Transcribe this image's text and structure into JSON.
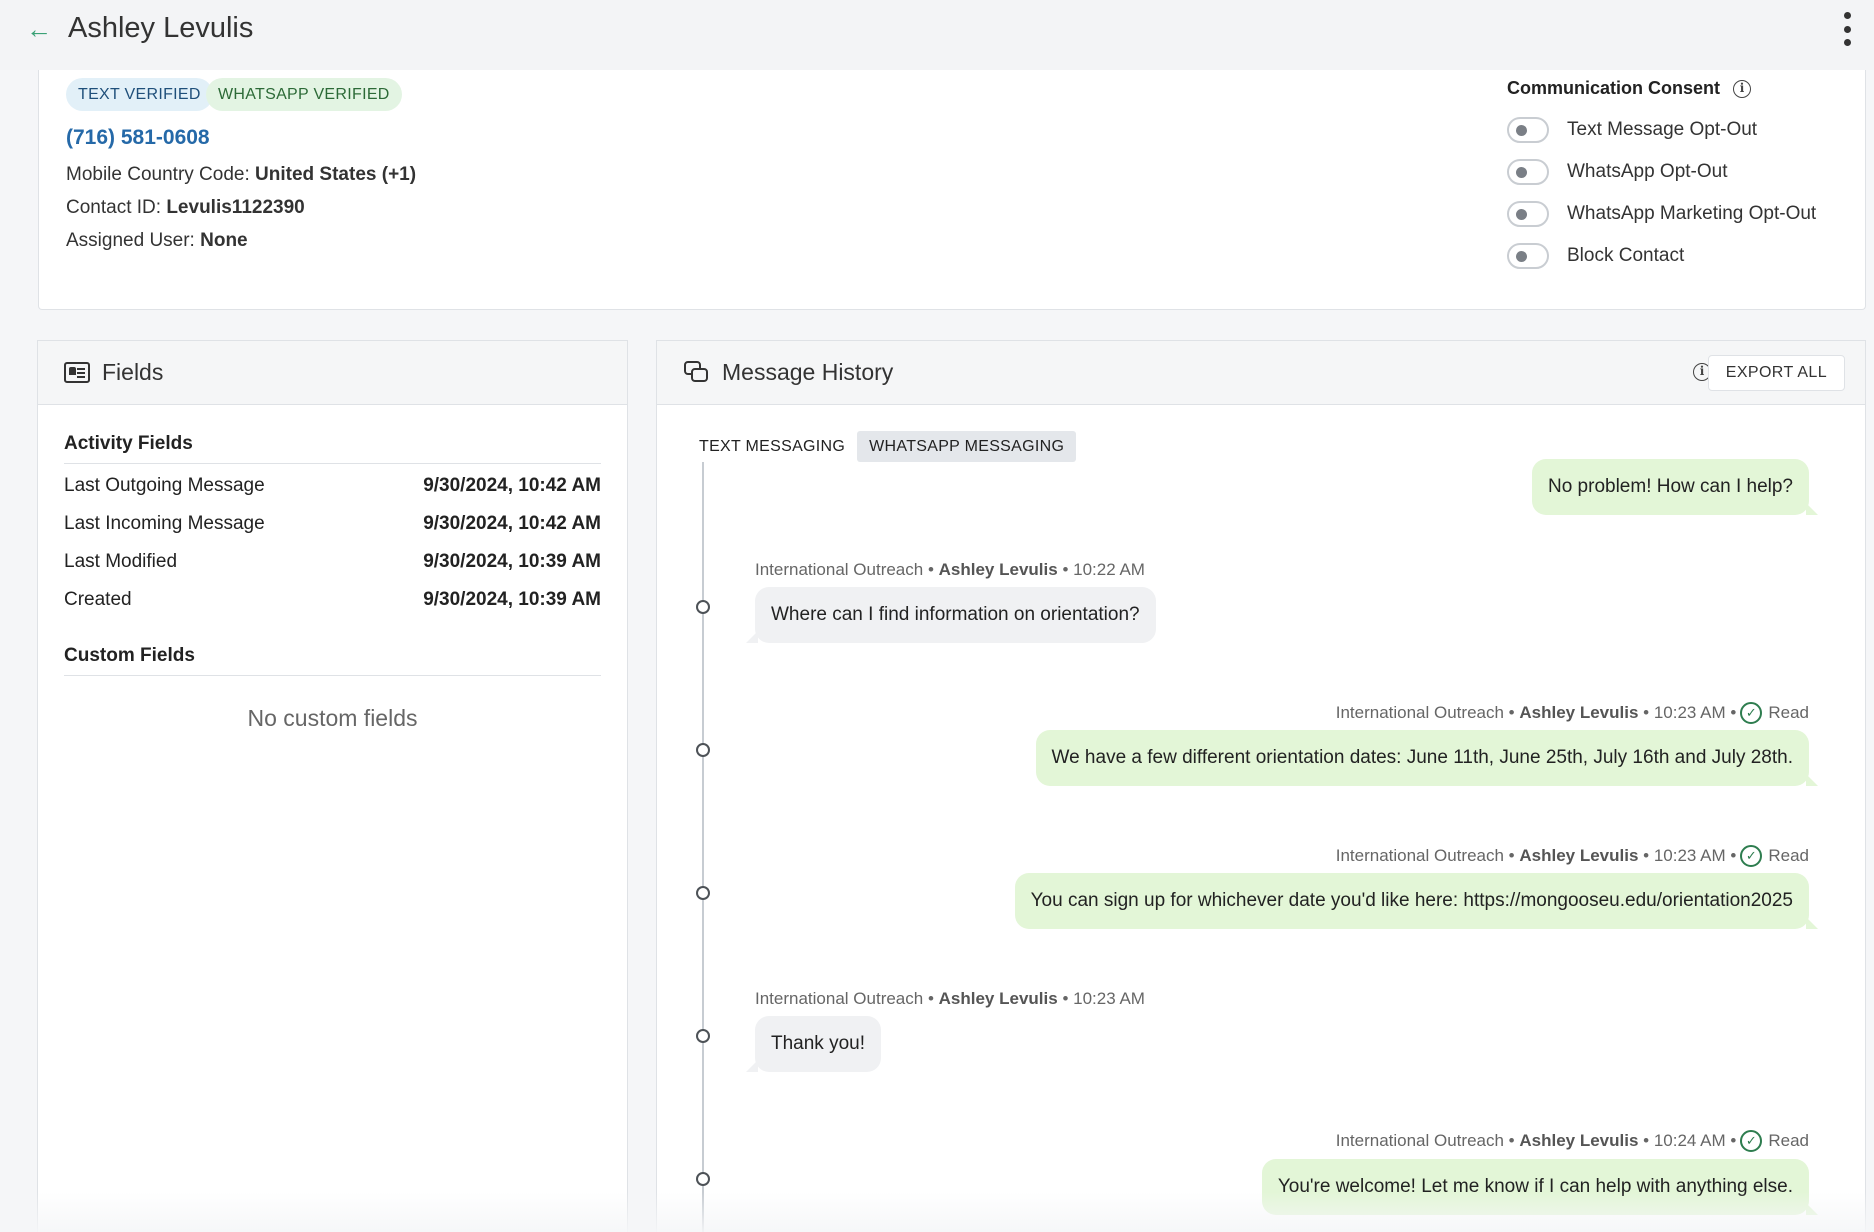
{
  "header": {
    "back_icon": "arrow-left-icon",
    "title": "Ashley Levulis",
    "menu_icon": "kebab-menu-icon"
  },
  "contact": {
    "badges": [
      "TEXT VERIFIED",
      "WHATSAPP VERIFIED"
    ],
    "phone": "(716) 581-0608",
    "mobile_country_code_label": "Mobile Country Code:",
    "mobile_country_code": "United States (+1)",
    "contact_id_label": "Contact ID:",
    "contact_id": "Levulis1122390",
    "assigned_user_label": "Assigned User:",
    "assigned_user": "None"
  },
  "consent": {
    "title": "Communication Consent",
    "info_icon": "i",
    "options": [
      {
        "label": "Text Message Opt-Out",
        "on": false
      },
      {
        "label": "WhatsApp Opt-Out",
        "on": false
      },
      {
        "label": "WhatsApp Marketing Opt-Out",
        "on": false
      },
      {
        "label": "Block Contact",
        "on": false
      }
    ]
  },
  "fields": {
    "title": "Fields",
    "activity_title": "Activity Fields",
    "activity": [
      {
        "label": "Last Outgoing Message",
        "value": "9/30/2024, 10:42 AM"
      },
      {
        "label": "Last Incoming Message",
        "value": "9/30/2024, 10:42 AM"
      },
      {
        "label": "Last Modified",
        "value": "9/30/2024, 10:39 AM"
      },
      {
        "label": "Created",
        "value": "9/30/2024, 10:39 AM"
      }
    ],
    "custom_title": "Custom Fields",
    "no_custom": "No custom fields"
  },
  "messages": {
    "title": "Message History",
    "info_icon": "i",
    "export_label": "EXPORT ALL",
    "tabs": [
      {
        "label": "TEXT MESSAGING",
        "active": false
      },
      {
        "label": "WHATSAPP MESSAGING",
        "active": true
      }
    ],
    "items": [
      {
        "direction": "out",
        "text": "No problem! How can I help?"
      },
      {
        "direction": "in",
        "source": "International Outreach",
        "sep1": "•",
        "sender": "Ashley Levulis",
        "sep2": "•",
        "time": "10:22 AM",
        "text": "Where can I find information on orientation?"
      },
      {
        "direction": "out",
        "source": "International Outreach",
        "sep1": "•",
        "sender": "Ashley Levulis",
        "sep2": "•",
        "time": "10:23 AM",
        "sep3": "•",
        "status": "Read",
        "text": "We have a few different orientation dates: June 11th, June 25th, July 16th and July 28th."
      },
      {
        "direction": "out",
        "source": "International Outreach",
        "sep1": "•",
        "sender": "Ashley Levulis",
        "sep2": "•",
        "time": "10:23 AM",
        "sep3": "•",
        "status": "Read",
        "text": "You can sign up for whichever date you'd like here: https://mongooseu.edu/orientation2025"
      },
      {
        "direction": "in",
        "source": "International Outreach",
        "sep1": "•",
        "sender": "Ashley Levulis",
        "sep2": "•",
        "time": "10:23 AM",
        "text": "Thank you!"
      },
      {
        "direction": "out",
        "source": "International Outreach",
        "sep1": "•",
        "sender": "Ashley Levulis",
        "sep2": "•",
        "time": "10:24 AM",
        "sep3": "•",
        "status": "Read",
        "text": "You're welcome! Let me know if I can help with anything else."
      }
    ]
  },
  "colors": {
    "accent_green": "#3aa176",
    "link_blue": "#2569a8",
    "outgoing_bubble": "#e3f6d7",
    "incoming_bubble": "#f0f1f3"
  }
}
